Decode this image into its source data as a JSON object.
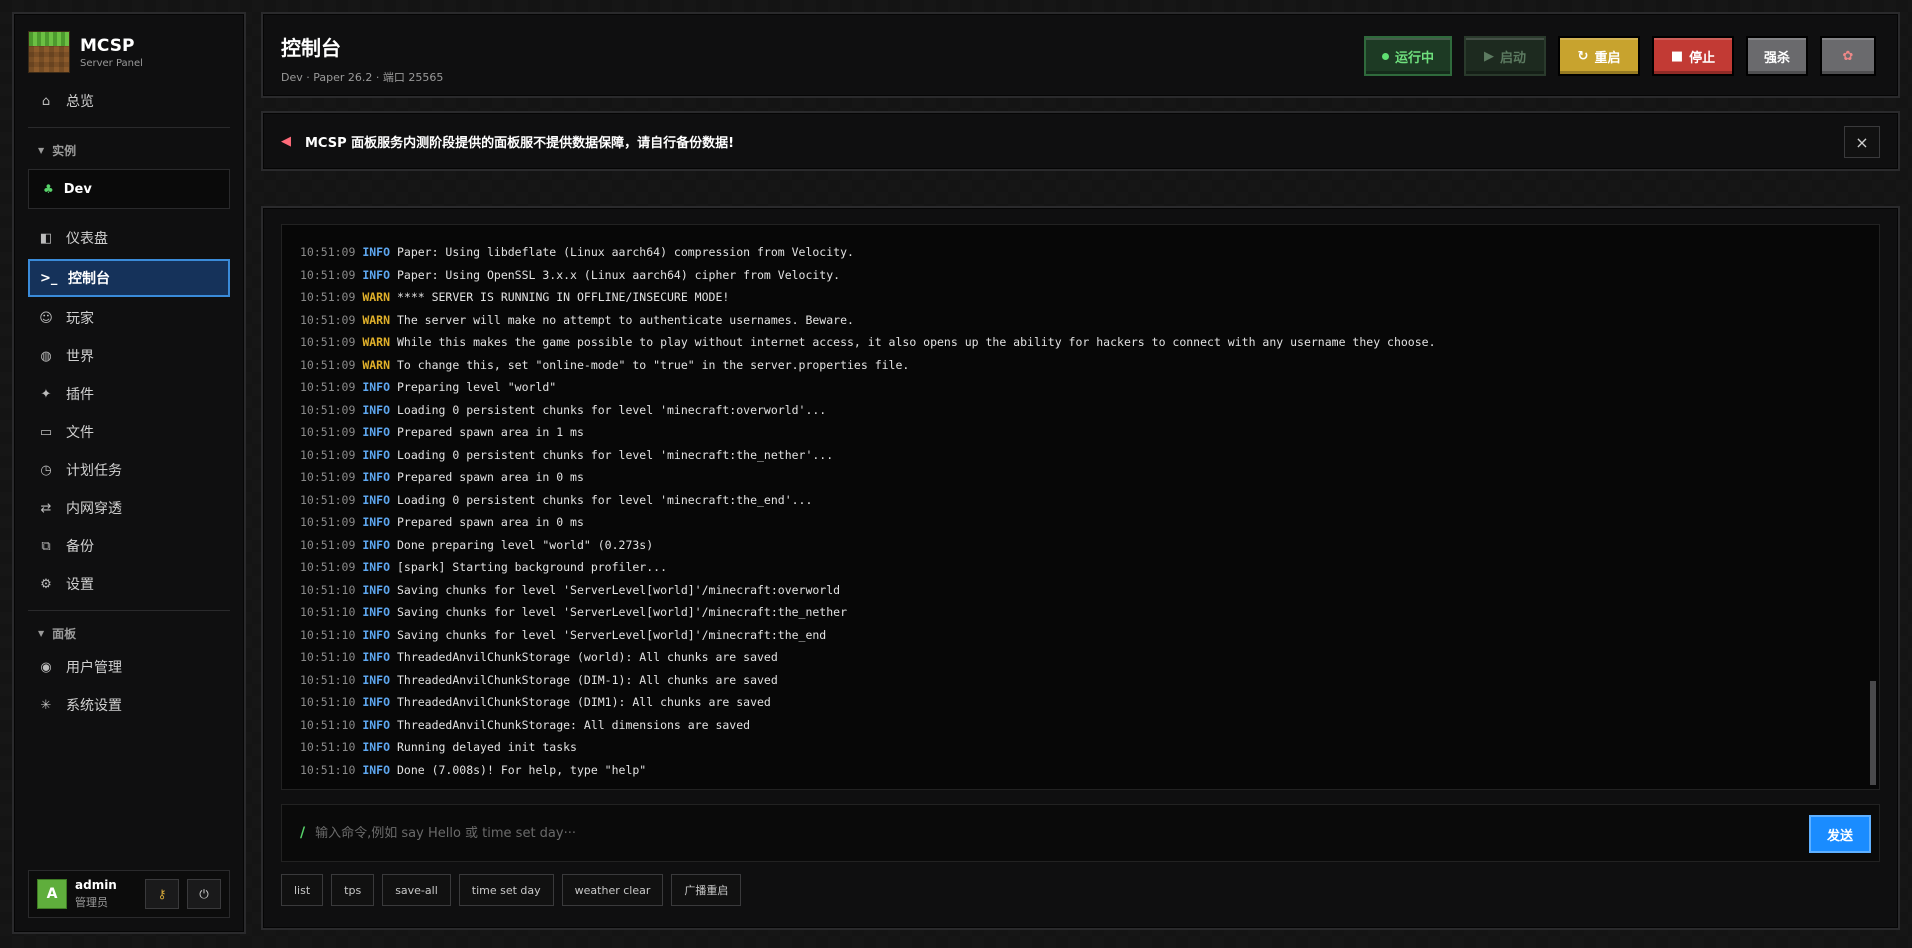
{
  "brand": {
    "name": "MCSP",
    "subtitle": "Server Panel"
  },
  "nav": {
    "overview": "总览",
    "instances_section": "实例",
    "instance_name": "Dev",
    "items": [
      {
        "icon": "◧",
        "label": "仪表盘"
      },
      {
        "icon": ">_",
        "label": "控制台"
      },
      {
        "icon": "☺",
        "label": "玩家"
      },
      {
        "icon": "◍",
        "label": "世界"
      },
      {
        "icon": "✦",
        "label": "插件"
      },
      {
        "icon": "▭",
        "label": "文件"
      },
      {
        "icon": "◷",
        "label": "计划任务"
      },
      {
        "icon": "⇄",
        "label": "内网穿透"
      },
      {
        "icon": "⧉",
        "label": "备份"
      },
      {
        "icon": "⚙",
        "label": "设置"
      }
    ],
    "panel_section": "面板",
    "panel_items": [
      {
        "icon": "◉",
        "label": "用户管理"
      },
      {
        "icon": "✳",
        "label": "系统设置"
      }
    ]
  },
  "user": {
    "avatar": "A",
    "name": "admin",
    "role": "管理员"
  },
  "header": {
    "title": "控制台",
    "subtitle": "Dev · Paper 26.2 · 端口 25565",
    "buttons": {
      "running": "运行中",
      "start": "启动",
      "restart": "重启",
      "stop": "停止",
      "kill": "强杀"
    }
  },
  "notice": {
    "text": "MCSP 面板服务内测阶段提供的面板服不提供数据保障，请自行备份数据!"
  },
  "console": {
    "lines": [
      {
        "time": "10:51:09",
        "level": "INFO",
        "msg": "Paper: Using libdeflate (Linux aarch64) compression from Velocity."
      },
      {
        "time": "10:51:09",
        "level": "INFO",
        "msg": "Paper: Using OpenSSL 3.x.x (Linux aarch64) cipher from Velocity."
      },
      {
        "time": "10:51:09",
        "level": "WARN",
        "msg": "**** SERVER IS RUNNING IN OFFLINE/INSECURE MODE!"
      },
      {
        "time": "10:51:09",
        "level": "WARN",
        "msg": "The server will make no attempt to authenticate usernames. Beware."
      },
      {
        "time": "10:51:09",
        "level": "WARN",
        "msg": "While this makes the game possible to play without internet access, it also opens up the ability for hackers to connect with any username they choose."
      },
      {
        "time": "10:51:09",
        "level": "WARN",
        "msg": "To change this, set \"online-mode\" to \"true\" in the server.properties file."
      },
      {
        "time": "10:51:09",
        "level": "INFO",
        "msg": "Preparing level \"world\""
      },
      {
        "time": "10:51:09",
        "level": "INFO",
        "msg": "Loading 0 persistent chunks for level 'minecraft:overworld'..."
      },
      {
        "time": "10:51:09",
        "level": "INFO",
        "msg": "Prepared spawn area in 1 ms"
      },
      {
        "time": "10:51:09",
        "level": "INFO",
        "msg": "Loading 0 persistent chunks for level 'minecraft:the_nether'..."
      },
      {
        "time": "10:51:09",
        "level": "INFO",
        "msg": "Prepared spawn area in 0 ms"
      },
      {
        "time": "10:51:09",
        "level": "INFO",
        "msg": "Loading 0 persistent chunks for level 'minecraft:the_end'..."
      },
      {
        "time": "10:51:09",
        "level": "INFO",
        "msg": "Prepared spawn area in 0 ms"
      },
      {
        "time": "10:51:09",
        "level": "INFO",
        "msg": "Done preparing level \"world\" (0.273s)"
      },
      {
        "time": "10:51:09",
        "level": "INFO",
        "msg": "[spark] Starting background profiler..."
      },
      {
        "time": "10:51:10",
        "level": "INFO",
        "msg": "Saving chunks for level 'ServerLevel[world]'/minecraft:overworld"
      },
      {
        "time": "10:51:10",
        "level": "INFO",
        "msg": "Saving chunks for level 'ServerLevel[world]'/minecraft:the_nether"
      },
      {
        "time": "10:51:10",
        "level": "INFO",
        "msg": "Saving chunks for level 'ServerLevel[world]'/minecraft:the_end"
      },
      {
        "time": "10:51:10",
        "level": "INFO",
        "msg": "ThreadedAnvilChunkStorage (world): All chunks are saved"
      },
      {
        "time": "10:51:10",
        "level": "INFO",
        "msg": "ThreadedAnvilChunkStorage (DIM-1): All chunks are saved"
      },
      {
        "time": "10:51:10",
        "level": "INFO",
        "msg": "ThreadedAnvilChunkStorage (DIM1): All chunks are saved"
      },
      {
        "time": "10:51:10",
        "level": "INFO",
        "msg": "ThreadedAnvilChunkStorage: All dimensions are saved"
      },
      {
        "time": "10:51:10",
        "level": "INFO",
        "msg": "Running delayed init tasks"
      },
      {
        "time": "10:51:10",
        "level": "INFO",
        "msg": "Done (7.008s)! For help, type \"help\""
      }
    ]
  },
  "command": {
    "prompt": "/",
    "placeholder": "输入命令,例如 say Hello 或 time set day···",
    "send": "发送"
  },
  "quick_commands": [
    "list",
    "tps",
    "save-all",
    "time set day",
    "weather clear",
    "广播重启"
  ],
  "colors": {
    "info": "#5ea7f0",
    "warn": "#e0b02a",
    "accent": "#1a8cff",
    "running": "#5fe072"
  }
}
